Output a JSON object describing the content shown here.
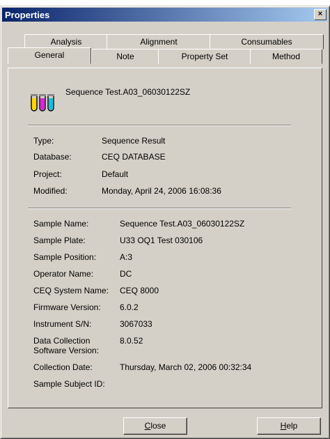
{
  "window": {
    "title": "Properties",
    "close_glyph": "×"
  },
  "tabs": {
    "row1": [
      "Analysis",
      "Alignment",
      "Consumables"
    ],
    "row2": [
      "General",
      "Note",
      "Property Set",
      "Method"
    ],
    "selected": "General"
  },
  "header": {
    "sequence_name": "Sequence Test.A03_06030122SZ",
    "icon": "test-tubes-icon"
  },
  "section1": [
    {
      "label": "Type:",
      "value": "Sequence Result"
    },
    {
      "label": "Database:",
      "value": "CEQ DATABASE"
    },
    {
      "label": "Project:",
      "value": "Default"
    },
    {
      "label": "Modified:",
      "value": "Monday, April 24, 2006 16:08:36"
    }
  ],
  "section2": [
    {
      "label": "Sample Name:",
      "value": "Sequence Test.A03_06030122SZ"
    },
    {
      "label": "Sample Plate:",
      "value": "U33 OQ1 Test 030106"
    },
    {
      "label": "Sample Position:",
      "value": "A:3"
    },
    {
      "label": "Operator Name:",
      "value": "DC"
    },
    {
      "label": "CEQ System Name:",
      "value": "CEQ 8000"
    },
    {
      "label": "Firmware Version:",
      "value": "6.0.2"
    },
    {
      "label": "Instrument S/N:",
      "value": "3067033"
    },
    {
      "label": "Data Collection",
      "label2": "Software Version:",
      "value": "8.0.52"
    },
    {
      "label": "Collection Date:",
      "value": "Thursday, March 02, 2006 00:32:34"
    },
    {
      "label": "Sample Subject ID:",
      "value": ""
    }
  ],
  "buttons": {
    "close_first": "C",
    "close_rest": "lose",
    "help_first": "H",
    "help_rest": "elp"
  }
}
